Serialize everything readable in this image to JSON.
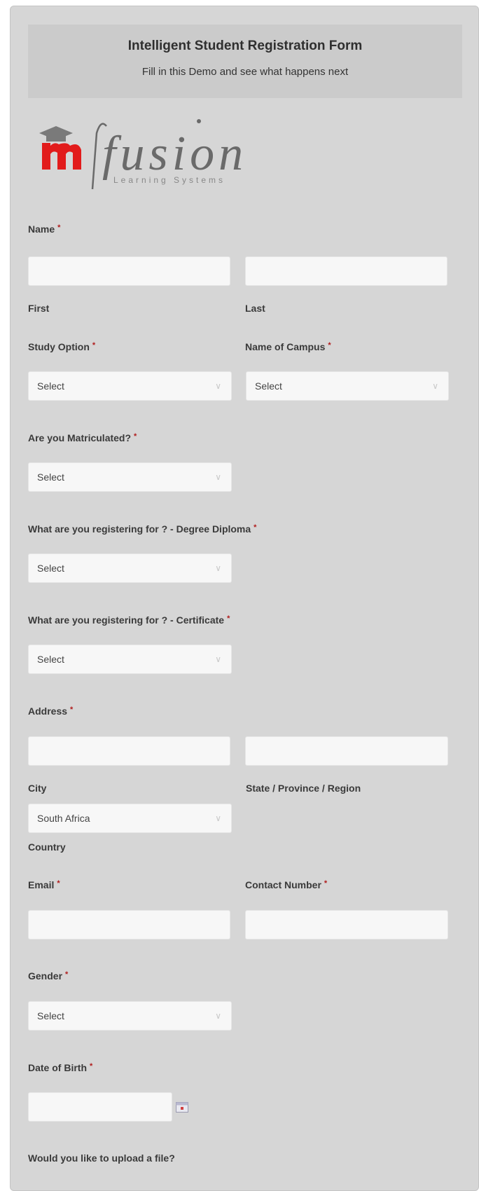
{
  "header": {
    "title": "Intelligent Student Registration Form",
    "subtitle": "Fill in this Demo and see what happens next"
  },
  "logo": {
    "word": "fusion",
    "tagline": "Learning Systems",
    "brand_color": "#e21b1b"
  },
  "required_marker": "*",
  "name": {
    "label": "Name",
    "first_sublabel": "First",
    "last_sublabel": "Last",
    "first_value": "",
    "last_value": ""
  },
  "study_option": {
    "label": "Study Option",
    "value": "Select"
  },
  "campus": {
    "label": "Name of Campus",
    "value": "Select"
  },
  "matriculated": {
    "label": "Are you Matriculated?",
    "value": "Select"
  },
  "degree_diploma": {
    "label": "What are you registering for ? - Degree Diploma",
    "value": "Select"
  },
  "certificate": {
    "label": "What are you registering for ? - Certificate",
    "value": "Select"
  },
  "address": {
    "label": "Address",
    "city_sublabel": "City",
    "state_sublabel": "State / Province / Region",
    "country_sublabel": "Country",
    "country_value": "South Africa"
  },
  "email": {
    "label": "Email",
    "value": ""
  },
  "contact": {
    "label": "Contact Number",
    "value": ""
  },
  "gender": {
    "label": "Gender",
    "value": "Select"
  },
  "dob": {
    "label": "Date of Birth",
    "value": "",
    "icon": "calendar-icon"
  },
  "upload": {
    "label": "Would you like to upload a file?"
  },
  "icons": {
    "select_chevron": "chevron-down-icon"
  }
}
